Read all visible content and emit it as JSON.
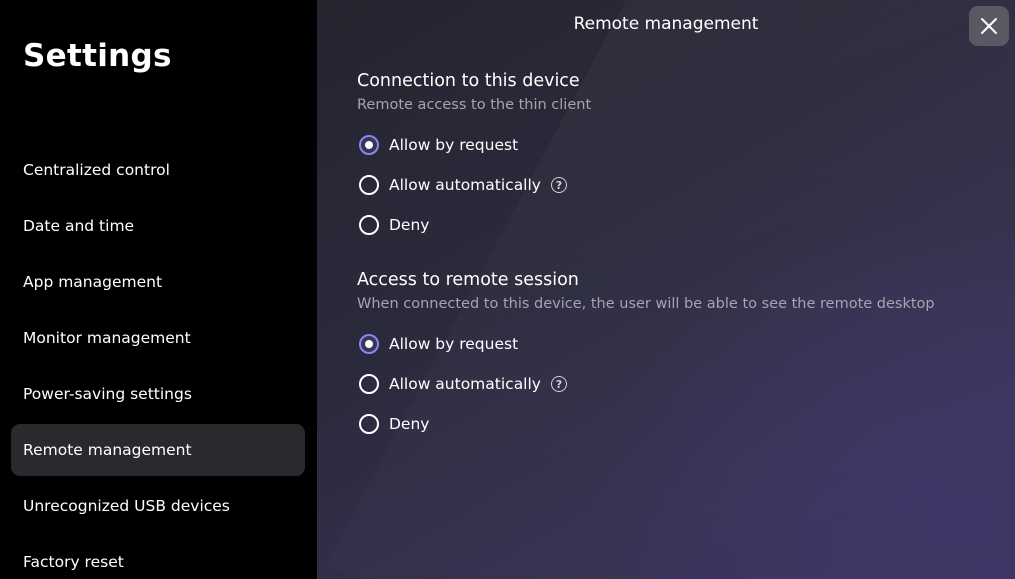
{
  "sidebar": {
    "title": "Settings",
    "items": [
      {
        "label": "Centralized control"
      },
      {
        "label": "Date and time"
      },
      {
        "label": "App management"
      },
      {
        "label": "Monitor management"
      },
      {
        "label": "Power-saving settings"
      },
      {
        "label": "Remote management",
        "active": true
      },
      {
        "label": "Unrecognized USB devices"
      },
      {
        "label": "Factory reset"
      }
    ]
  },
  "main": {
    "title": "Remote management",
    "close_icon": "close-icon",
    "help_icon": "question-circle-icon",
    "sections": [
      {
        "title": "Connection to this device",
        "subtitle": "Remote access to the thin client",
        "options": [
          {
            "label": "Allow by request",
            "checked": true
          },
          {
            "label": "Allow automatically",
            "help": true
          },
          {
            "label": "Deny"
          }
        ]
      },
      {
        "title": "Access to remote session",
        "subtitle": "When connected to this device, the user will be able to see the remote desktop",
        "options": [
          {
            "label": "Allow by request",
            "checked": true
          },
          {
            "label": "Allow automatically",
            "help": true
          },
          {
            "label": "Deny"
          }
        ]
      }
    ]
  },
  "colors": {
    "accent": "#8b84f2",
    "sidebar_bg": "#000000",
    "active_item_bg": "#2a2a2e",
    "close_button_bg": "#5a5863",
    "subtitle_text": "#a6a4b0"
  }
}
